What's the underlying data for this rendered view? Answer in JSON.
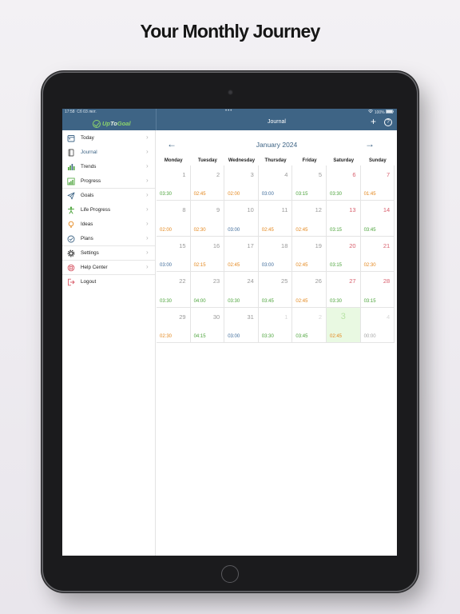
{
  "headline": "Your Monthly Journey",
  "status": {
    "time": "17:58",
    "date": "Сб 03 лют.",
    "right": "100%"
  },
  "app": {
    "logo_prefix": "Up",
    "logo_middle": "To",
    "logo_suffix": "Goal",
    "nav_title": "Journal",
    "add_icon": "+",
    "help_icon": "?"
  },
  "sidebar": {
    "items": [
      {
        "label": "Today",
        "icon": "calendar-icon"
      },
      {
        "label": "Journal",
        "icon": "journal-icon",
        "active": true
      },
      {
        "label": "Trends",
        "icon": "trends-icon"
      },
      {
        "label": "Progress",
        "icon": "progress-icon"
      },
      {
        "label": "Goals",
        "icon": "paper-plane-icon"
      },
      {
        "label": "Life Progress",
        "icon": "life-progress-icon"
      },
      {
        "label": "Ideas",
        "icon": "lightbulb-icon"
      },
      {
        "label": "Plans",
        "icon": "check-circle-icon"
      },
      {
        "label": "Settings",
        "icon": "gear-icon"
      },
      {
        "label": "Help Center",
        "icon": "lifebuoy-icon"
      },
      {
        "label": "Logout",
        "icon": "logout-icon"
      }
    ]
  },
  "calendar": {
    "month": "January 2024",
    "prev_icon": "←",
    "next_icon": "→",
    "weekdays": [
      "Monday",
      "Tuesday",
      "Wednesday",
      "Thursday",
      "Friday",
      "Saturday",
      "Sunday"
    ],
    "weeks": [
      [
        {
          "day": "1",
          "time": "03:30",
          "color": "green"
        },
        {
          "day": "2",
          "time": "02:45",
          "color": "orange"
        },
        {
          "day": "3",
          "time": "02:00",
          "color": "orange"
        },
        {
          "day": "4",
          "time": "03:00",
          "color": "blue"
        },
        {
          "day": "5",
          "time": "03:15",
          "color": "green"
        },
        {
          "day": "6",
          "time": "03:30",
          "color": "green",
          "weekend": true
        },
        {
          "day": "7",
          "time": "01:45",
          "color": "orange",
          "weekend": true
        }
      ],
      [
        {
          "day": "8",
          "time": "02:00",
          "color": "orange"
        },
        {
          "day": "9",
          "time": "02:30",
          "color": "orange"
        },
        {
          "day": "10",
          "time": "03:00",
          "color": "blue"
        },
        {
          "day": "11",
          "time": "02:45",
          "color": "orange"
        },
        {
          "day": "12",
          "time": "02:45",
          "color": "orange"
        },
        {
          "day": "13",
          "time": "03:15",
          "color": "green",
          "weekend": true
        },
        {
          "day": "14",
          "time": "03:45",
          "color": "green",
          "weekend": true
        }
      ],
      [
        {
          "day": "15",
          "time": "03:00",
          "color": "blue"
        },
        {
          "day": "16",
          "time": "02:15",
          "color": "orange"
        },
        {
          "day": "17",
          "time": "02:45",
          "color": "orange"
        },
        {
          "day": "18",
          "time": "03:00",
          "color": "blue"
        },
        {
          "day": "19",
          "time": "02:45",
          "color": "orange"
        },
        {
          "day": "20",
          "time": "03:15",
          "color": "green",
          "weekend": true
        },
        {
          "day": "21",
          "time": "02:30",
          "color": "orange",
          "weekend": true
        }
      ],
      [
        {
          "day": "22",
          "time": "03:30",
          "color": "green"
        },
        {
          "day": "23",
          "time": "04:00",
          "color": "green"
        },
        {
          "day": "24",
          "time": "03:30",
          "color": "green"
        },
        {
          "day": "25",
          "time": "03:45",
          "color": "green"
        },
        {
          "day": "26",
          "time": "02:45",
          "color": "orange"
        },
        {
          "day": "27",
          "time": "03:30",
          "color": "green",
          "weekend": true
        },
        {
          "day": "28",
          "time": "03:15",
          "color": "green",
          "weekend": true
        }
      ],
      [
        {
          "day": "29",
          "time": "02:30",
          "color": "orange"
        },
        {
          "day": "30",
          "time": "04:15",
          "color": "green"
        },
        {
          "day": "31",
          "time": "03:00",
          "color": "blue"
        },
        {
          "day": "1",
          "time": "03:30",
          "color": "green",
          "other": true
        },
        {
          "day": "2",
          "time": "03:45",
          "color": "green",
          "other": true
        },
        {
          "day": "3",
          "time": "02:45",
          "color": "orange",
          "other": true,
          "today": true
        },
        {
          "day": "4",
          "time": "00:00",
          "color": "gray",
          "other": true
        }
      ]
    ]
  },
  "colors": {
    "header": "#3e6485",
    "green": "#4ba33a",
    "orange": "#e4871c",
    "blue": "#3e6b9a",
    "weekend": "#d9606e"
  }
}
